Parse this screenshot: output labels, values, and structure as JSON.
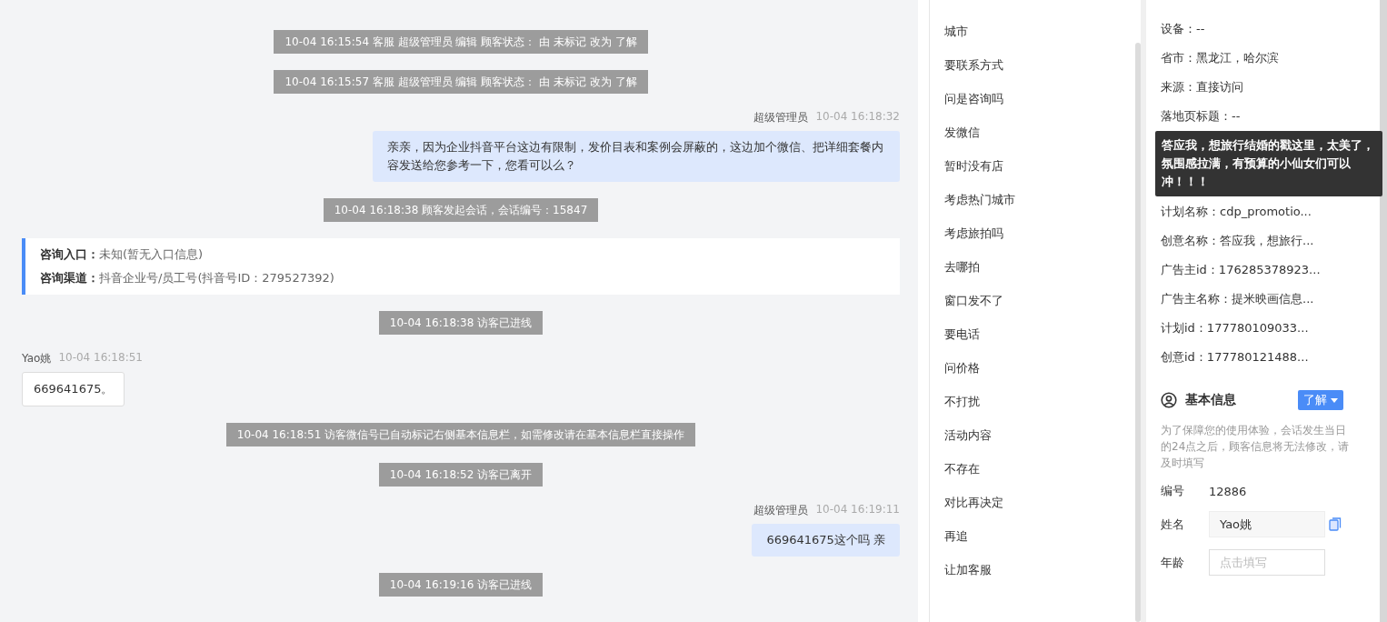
{
  "chat": {
    "messages": [
      {
        "kind": "system",
        "text": "10-04 16:15:54 客服 超级管理员 编辑 顾客状态： 由 未标记 改为 了解"
      },
      {
        "kind": "system",
        "text": "10-04 16:15:57 客服 超级管理员 编辑 顾客状态： 由 未标记 改为 了解"
      },
      {
        "kind": "agent",
        "sender": "超级管理员",
        "time": "10-04 16:18:32",
        "text": "亲亲，因为企业抖音平台这边有限制，发价目表和案例会屏蔽的，这边加个微信、把详细套餐内容发送给您参考一下，您看可以么？"
      },
      {
        "kind": "system",
        "text": "10-04 16:18:38 顾客发起会话，会话编号：15847"
      },
      {
        "kind": "info",
        "rows": [
          {
            "label": "咨询入口：",
            "value": "未知(暂无入口信息)"
          },
          {
            "label": "咨询渠道：",
            "value": "抖音企业号/员工号(抖音号ID：279527392)"
          }
        ]
      },
      {
        "kind": "system",
        "text": "10-04 16:18:38 访客已进线"
      },
      {
        "kind": "visitor",
        "sender": "Yao姚",
        "time": "10-04 16:18:51",
        "text": "669641675。"
      },
      {
        "kind": "system",
        "text": "10-04 16:18:51 访客微信号已自动标记右侧基本信息栏，如需修改请在基本信息栏直接操作"
      },
      {
        "kind": "system",
        "text": "10-04 16:18:52 访客已离开"
      },
      {
        "kind": "agent",
        "sender": "超级管理员",
        "time": "10-04 16:19:11",
        "text": "669641675这个吗 亲"
      },
      {
        "kind": "system",
        "text": "10-04 16:19:16 访客已进线"
      }
    ]
  },
  "quick_replies": {
    "items": [
      "城市",
      "要联系方式",
      "问是咨询吗",
      "发微信",
      "暂时没有店",
      "考虑热门城市",
      "考虑旅拍吗",
      "去哪拍",
      "窗口发不了",
      "要电话",
      "问价格",
      "不打扰",
      "活动内容",
      "不存在",
      "对比再决定",
      "再追",
      "让加客服"
    ]
  },
  "details": {
    "rows_before": [
      "设备：--",
      "省市：黑龙江，哈尔滨",
      "来源：直接访问",
      "落地页标题：--"
    ],
    "tooltip": "答应我，想旅行结婚的戳这里，太美了，氛围感拉满，有预算的小仙女们可以冲！！！",
    "rows_after": [
      "计划名称：cdp_promotio...",
      "创意名称：答应我，想旅行...",
      "广告主id：176285378923...",
      "广告主名称：提米映画信息...",
      "计划id：177780109033...",
      "创意id：177780121488..."
    ]
  },
  "basic_info": {
    "title": "基本信息",
    "status": "了解",
    "notice": "为了保障您的使用体验，会话发生当日的24点之后，顾客信息将无法修改，请及时填写",
    "fields": [
      {
        "kind": "text",
        "label": "编号",
        "value": "12886"
      },
      {
        "kind": "input",
        "label": "姓名",
        "value": "Yao姚",
        "copy": true
      },
      {
        "kind": "input",
        "label": "年龄",
        "placeholder": "点击填写",
        "copy": false
      }
    ]
  }
}
